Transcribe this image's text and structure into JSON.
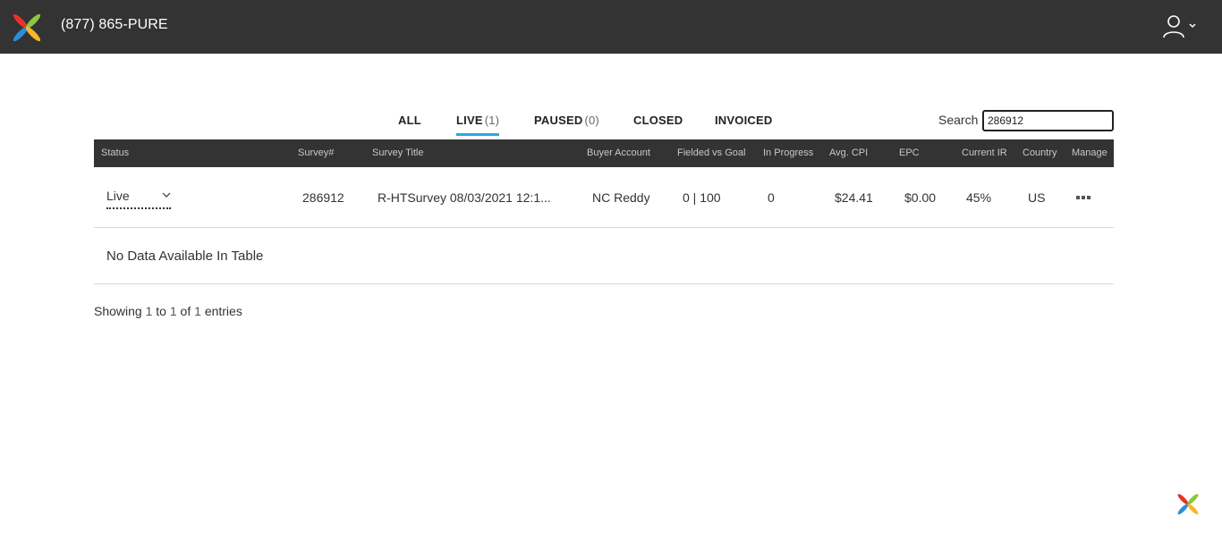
{
  "header": {
    "phone": "(877) 865-PURE",
    "logo_icon": "pinwheel-logo-icon",
    "user_icon": "user-icon",
    "menu_icon": "chevron-down-icon"
  },
  "tabs": [
    {
      "label": "ALL",
      "count": ""
    },
    {
      "label": "LIVE",
      "count": "(1)"
    },
    {
      "label": "PAUSED",
      "count": "(0)"
    },
    {
      "label": "CLOSED",
      "count": ""
    },
    {
      "label": "INVOICED",
      "count": ""
    }
  ],
  "active_tab": "LIVE",
  "search": {
    "label": "Search",
    "value": "286912"
  },
  "table": {
    "columns": [
      "Status",
      "Survey#",
      "Survey Title",
      "Buyer Account",
      "Fielded vs Goal",
      "In Progress",
      "Avg. CPI",
      "EPC",
      "Current IR",
      "Country",
      "Manage"
    ],
    "rows": [
      {
        "status": "Live",
        "survey_no": "286912",
        "title": "R-HTSurvey 08/03/2021 12:1...",
        "buyer": "NC Reddy",
        "fielded_vs_goal": "0 | 100",
        "in_progress": "0",
        "avg_cpi": "$24.41",
        "epc": "$0.00",
        "current_ir": "45%",
        "country": "US",
        "manage_icon": "more-dots-icon"
      }
    ],
    "empty_message": "No Data Available In Table"
  },
  "footer": {
    "showing_prefix": "Showing",
    "from": "1",
    "to_word": "to",
    "to": "1",
    "of_word": "of",
    "total": "1",
    "suffix": "entries"
  },
  "colors": {
    "header_bg": "#333333",
    "accent": "#29a9e1"
  }
}
